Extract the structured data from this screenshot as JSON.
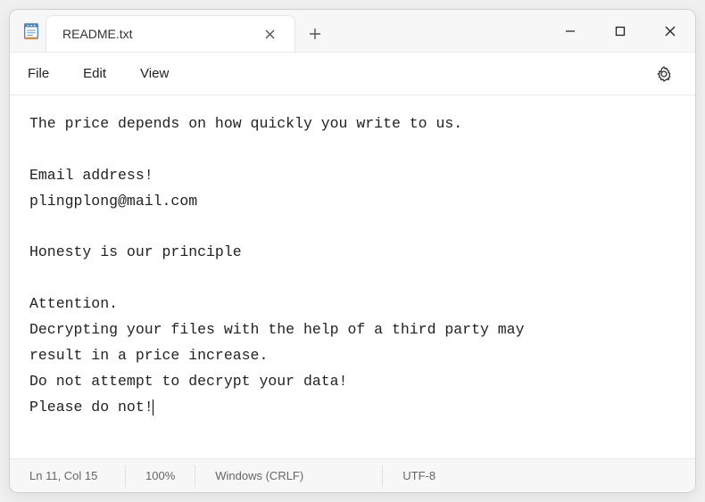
{
  "tab": {
    "title": "README.txt"
  },
  "menu": {
    "file": "File",
    "edit": "Edit",
    "view": "View"
  },
  "content": {
    "line1": "The price depends on how quickly you write to us.",
    "blank1": "",
    "line2": "Email address!",
    "line3": "plingplong@mail.com",
    "blank2": "",
    "line4": "Honesty is our principle",
    "blank3": "",
    "line5": "Attention.",
    "line6": "Decrypting your files with the help of a third party may",
    "line7": "result in a price increase.",
    "line8": "Do not attempt to decrypt your data!",
    "line9": "Please do not!"
  },
  "status": {
    "pos": "Ln 11, Col 15",
    "zoom": "100%",
    "lineend": "Windows (CRLF)",
    "encoding": "UTF-8"
  }
}
